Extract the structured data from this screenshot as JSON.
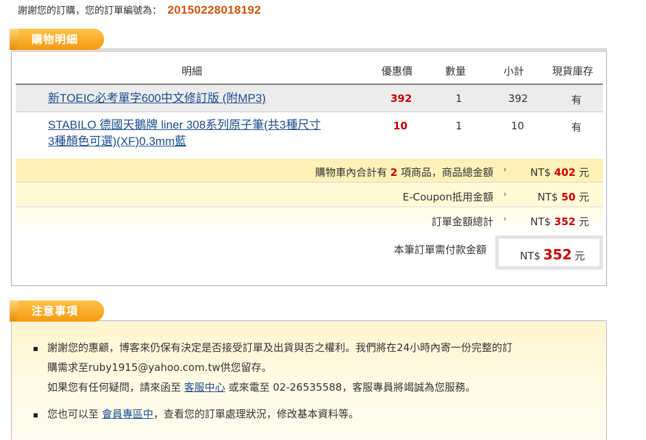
{
  "header": {
    "thanks_text": "謝謝您的訂購，您的訂單編號為：",
    "order_number": "20150228018192"
  },
  "cart_section": {
    "title": "購物明細",
    "columns": [
      "明細",
      "優惠價",
      "數量",
      "小計",
      "現貨庫存"
    ],
    "items": [
      {
        "name": "新TOEIC必考單字600中文修訂版 (附MP3)",
        "price": "392",
        "qty": "1",
        "subtotal": "392",
        "stock": "有"
      },
      {
        "name_line1": "STABILO 德國天鵝牌 liner 308系列原子筆(共3種尺寸",
        "name_line2": "3種顏色可選)(XF)0.3mm藍",
        "price": "10",
        "qty": "1",
        "subtotal": "10",
        "stock": "有"
      }
    ],
    "summary": {
      "count_prefix": "購物車內合計有",
      "count": "2",
      "count_suffix": "項商品，商品總金額",
      "goods_total_currency": "NT$",
      "goods_total": "402",
      "unit": "元",
      "coupon_label": "E-Coupon抵用金額",
      "coupon_amount": "50",
      "order_total_label": "訂單金額總計",
      "order_total": "352",
      "pay_label": "本筆訂單需付款金額",
      "pay_amount": "352",
      "arrow": "›"
    }
  },
  "notes_section": {
    "title": "注意事項",
    "note1_line1": "謝謝您的惠顧，博客來仍保有決定是否接受訂單及出貨與否之權利。我們將在24小時內寄一份完整的訂",
    "note1_line2": "購需求至ruby1915@yahoo.com.tw供您留存。",
    "note1_line3_prefix": "如果您有任何疑問，請來函至",
    "note1_link": "客服中心",
    "note1_line3_suffix": "或來電至 02-26535588，客服專員將竭誠為您服務。",
    "note2_prefix": "您也可以至",
    "note2_link": "會員專區中",
    "note2_suffix": "，查看您的訂單處理狀況，修改基本資料等。"
  },
  "colors": {
    "accent_orange": "#f39a12",
    "order_number": "#d2520a",
    "price_red": "#cc0000",
    "link_blue": "#1a4d8f"
  }
}
